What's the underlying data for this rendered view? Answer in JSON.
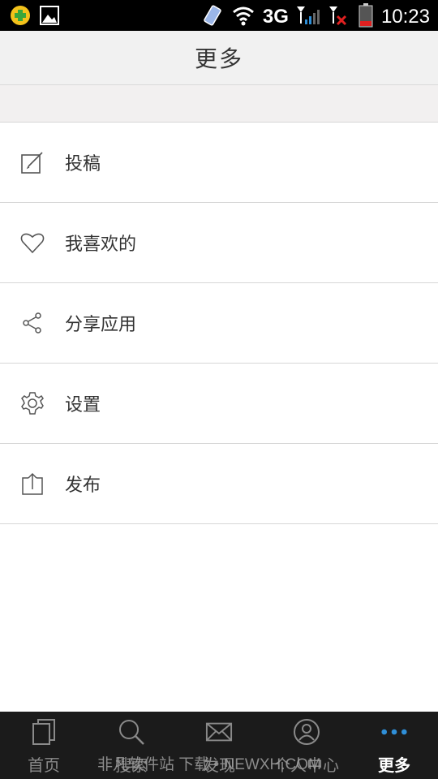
{
  "status_bar": {
    "network": "3G",
    "time": "10:23"
  },
  "header": {
    "title": "更多"
  },
  "menu": {
    "items": [
      {
        "label": "投稿",
        "icon": "edit-icon"
      },
      {
        "label": "我喜欢的",
        "icon": "heart-icon"
      },
      {
        "label": "分享应用",
        "icon": "share-icon"
      },
      {
        "label": "设置",
        "icon": "gear-icon"
      },
      {
        "label": "发布",
        "icon": "upload-icon"
      }
    ]
  },
  "bottom_nav": {
    "tabs": [
      {
        "label": "首页",
        "icon": "document-icon"
      },
      {
        "label": "搜索",
        "icon": "search-icon"
      },
      {
        "label": "发现",
        "icon": "mail-icon"
      },
      {
        "label": "个人中心",
        "icon": "user-icon"
      },
      {
        "label": "更多",
        "icon": "more-icon",
        "active": true
      }
    ],
    "watermark": "非凡软件站 下载 • NEWXH.COM"
  },
  "colors": {
    "active_accent": "#2f8fd8",
    "nav_bg": "#1b1b1b",
    "header_bg": "#f1f1f1"
  }
}
